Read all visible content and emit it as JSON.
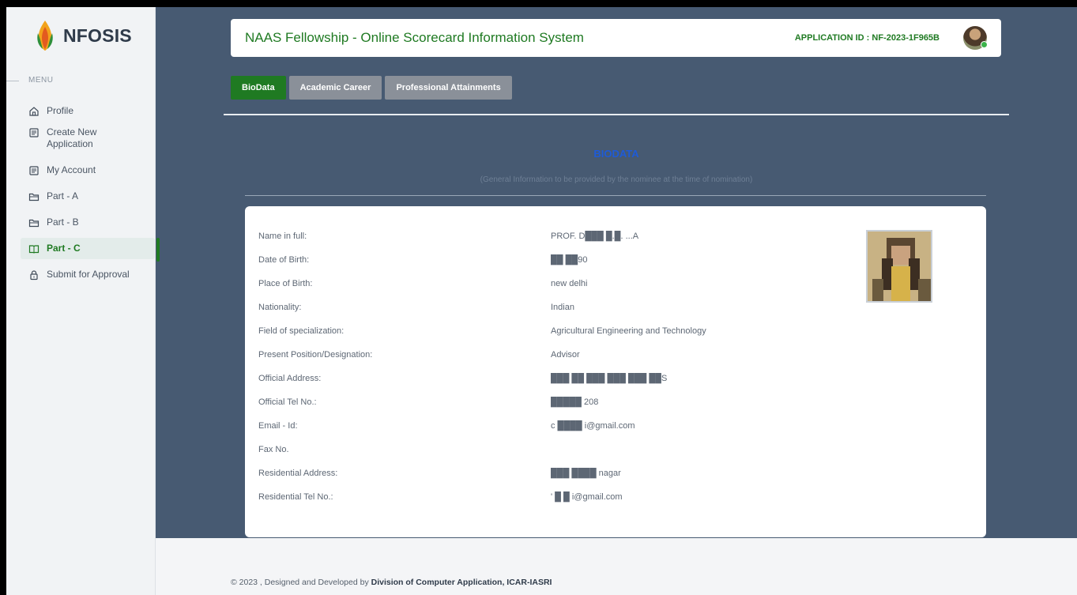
{
  "brand": {
    "name": "NFOSIS",
    "logo_icon": "leaf-flame-icon"
  },
  "sidebar": {
    "menu_label": "MENU",
    "items": [
      {
        "label": "Profile",
        "icon": "home-icon",
        "active": false
      },
      {
        "label": "Create New Application",
        "icon": "document-icon",
        "active": false
      },
      {
        "label": "My Account",
        "icon": "document-icon",
        "active": false
      },
      {
        "label": "Part - A",
        "icon": "folder-icon",
        "active": false
      },
      {
        "label": "Part - B",
        "icon": "folder-icon",
        "active": false
      },
      {
        "label": "Part - C",
        "icon": "book-icon",
        "active": true
      },
      {
        "label": "Submit for Approval",
        "icon": "lock-icon",
        "active": false
      }
    ]
  },
  "header": {
    "title": "NAAS Fellowship - Online Scorecard Information System",
    "application_id": "APPLICATION ID : NF-2023-1F965B",
    "avatar_icon": "user-avatar"
  },
  "tabs": [
    {
      "label": "BioData",
      "active": true
    },
    {
      "label": "Academic Career",
      "active": false
    },
    {
      "label": "Professional Attainments",
      "active": false
    }
  ],
  "section": {
    "title": "BIODATA",
    "subtitle": "(General Information to be provided by the nominee at the time of nomination)"
  },
  "biodata": [
    {
      "label": "Name in full:",
      "value": "PROF. D███ █.█. ...A"
    },
    {
      "label": "Date of Birth:",
      "value": "██ ██90"
    },
    {
      "label": "Place of Birth:",
      "value": "new delhi"
    },
    {
      "label": "Nationality:",
      "value": "Indian"
    },
    {
      "label": "Field of specialization:",
      "value": "Agricultural Engineering and Technology"
    },
    {
      "label": "Present Position/Designation:",
      "value": "Advisor"
    },
    {
      "label": "Official Address:",
      "value": "███ ██ ███ ███ ███ ██S"
    },
    {
      "label": "Official Tel No.:",
      "value": "█████ 208"
    },
    {
      "label": "Email - Id:",
      "value": "c ████ i@gmail.com"
    },
    {
      "label": "Fax No.",
      "value": ""
    },
    {
      "label": "Residential Address:",
      "value": "███ ████ nagar"
    },
    {
      "label": "Residential Tel No.:",
      "value": "' █ █ i@gmail.com"
    }
  ],
  "colors": {
    "accent": "#1f7a22",
    "background": "#475a72",
    "heading": "#1e5bd8"
  },
  "footer": {
    "prefix": "© 2023 , Designed and Developed by ",
    "org": "Division of Computer Application, ICAR-IASRI"
  }
}
